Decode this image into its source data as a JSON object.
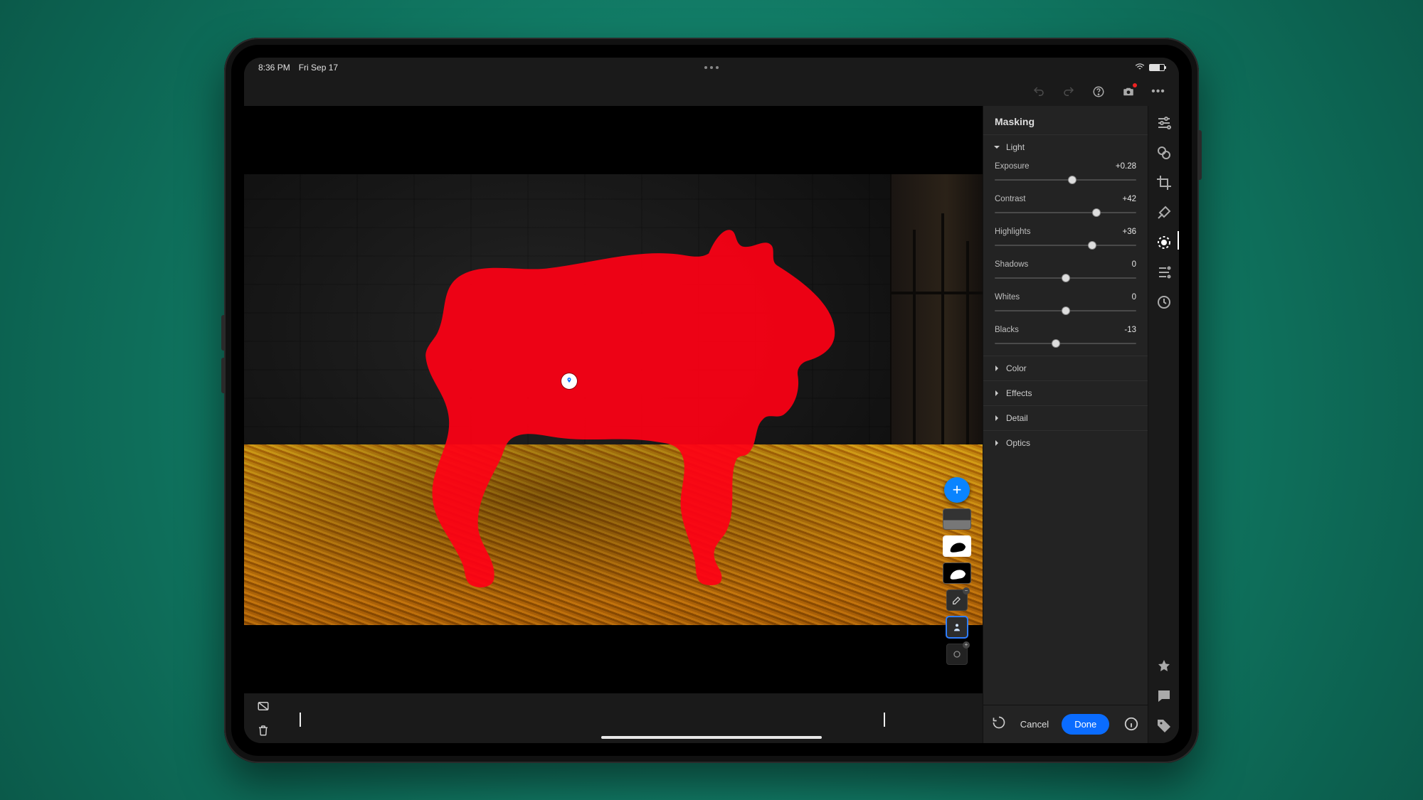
{
  "status": {
    "time": "8:36 PM",
    "date": "Fri Sep 17"
  },
  "panel": {
    "title": "Masking",
    "footer": {
      "cancel": "Cancel",
      "done": "Done"
    },
    "groups": {
      "light": "Light",
      "color": "Color",
      "effects": "Effects",
      "detail": "Detail",
      "optics": "Optics"
    },
    "sliders": {
      "exposure": {
        "label": "Exposure",
        "value": "+0.28",
        "pos": 55
      },
      "contrast": {
        "label": "Contrast",
        "value": "+42",
        "pos": 72
      },
      "highlights": {
        "label": "Highlights",
        "value": "+36",
        "pos": 69
      },
      "shadows": {
        "label": "Shadows",
        "value": "0",
        "pos": 50
      },
      "whites": {
        "label": "Whites",
        "value": "0",
        "pos": 50
      },
      "blacks": {
        "label": "Blacks",
        "value": "-13",
        "pos": 43
      }
    }
  },
  "colors": {
    "accent": "#0a6cff",
    "mask_overlay": "#ff0015"
  }
}
